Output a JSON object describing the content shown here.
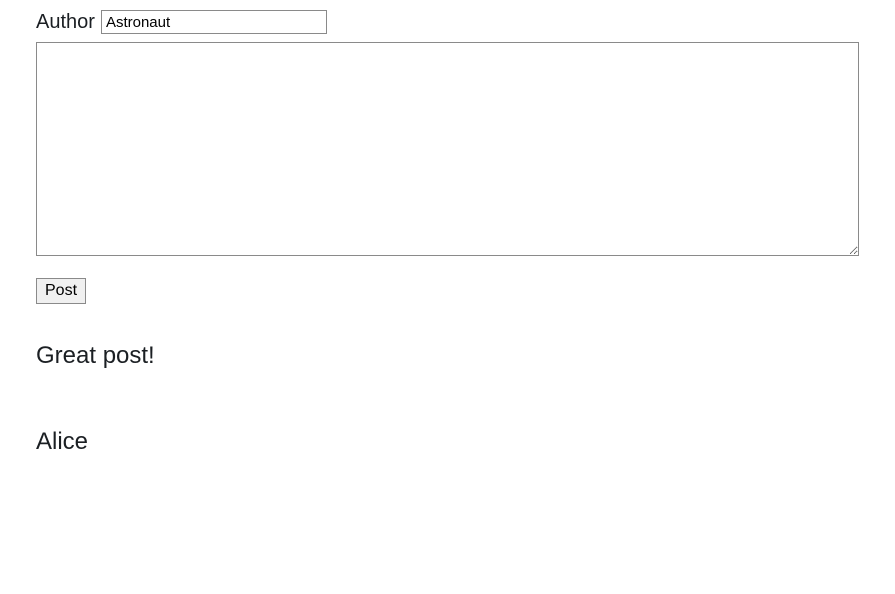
{
  "form": {
    "author_label": "Author",
    "author_value": "Astronaut",
    "body_value": "",
    "post_button_label": "Post"
  },
  "comments": [
    {
      "title": "Great post!",
      "author": "Alice"
    }
  ]
}
